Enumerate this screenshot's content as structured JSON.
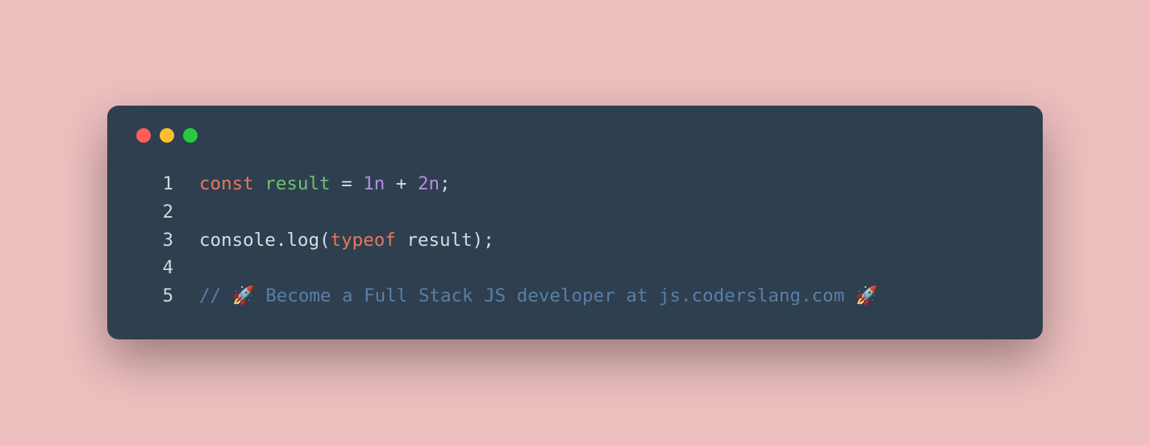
{
  "code": {
    "lines": [
      {
        "num": "1",
        "tokens": [
          {
            "cls": "tok-keyword",
            "text": "const "
          },
          {
            "cls": "tok-ident",
            "text": "result"
          },
          {
            "cls": "tok-op",
            "text": " = "
          },
          {
            "cls": "tok-num",
            "text": "1n"
          },
          {
            "cls": "tok-op",
            "text": " + "
          },
          {
            "cls": "tok-num",
            "text": "2n"
          },
          {
            "cls": "tok-default",
            "text": ";"
          }
        ]
      },
      {
        "num": "2",
        "tokens": []
      },
      {
        "num": "3",
        "tokens": [
          {
            "cls": "tok-default",
            "text": "console.log("
          },
          {
            "cls": "tok-keyword",
            "text": "typeof"
          },
          {
            "cls": "tok-default",
            "text": " result);"
          }
        ]
      },
      {
        "num": "4",
        "tokens": []
      },
      {
        "num": "5",
        "tokens": [
          {
            "cls": "tok-comment",
            "text": "// 🚀 Become a Full Stack JS developer at js.coderslang.com 🚀"
          }
        ]
      }
    ]
  }
}
